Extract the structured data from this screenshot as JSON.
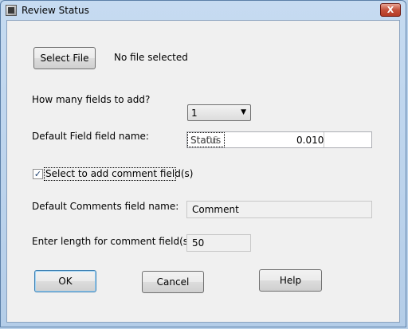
{
  "window": {
    "title": "Review Status",
    "close_glyph": "X",
    "icon": "app-icon",
    "accent_close": "#c4513b"
  },
  "file": {
    "button_label": "Select File",
    "status": "No file selected"
  },
  "fields": {
    "count_label": "How many fields to add?",
    "count_value": "1",
    "count_arrow": "▼",
    "name_label": "Default Field field name:",
    "name_value_a": "Status",
    "name_value_b": "Sta06",
    "name_numeric": "0.010"
  },
  "comment": {
    "checkbox_label": "Select to add comment field(s)",
    "checkbox_checked": true,
    "checkbox_glyph": "✓",
    "name_label": "Default Comments field name:",
    "name_value": "Comment",
    "length_label": "Enter length for comment field(s):",
    "length_value": "50"
  },
  "actions": {
    "ok": "OK",
    "cancel": "Cancel",
    "help": "Help"
  }
}
